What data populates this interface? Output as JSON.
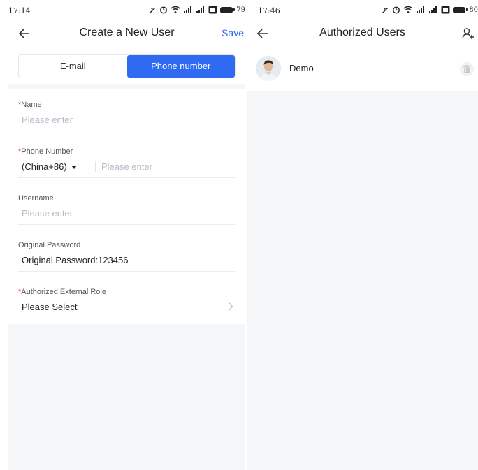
{
  "left_screen": {
    "status": {
      "time": "17:14",
      "battery": "79"
    },
    "nav": {
      "title": "Create a New User",
      "save": "Save"
    },
    "tabs": [
      {
        "label": "E-mail",
        "active": false
      },
      {
        "label": "Phone number",
        "active": true
      }
    ],
    "fields": {
      "name": {
        "required_mark": "*",
        "label": "Name",
        "placeholder": "Please enter"
      },
      "phone": {
        "required_mark": "*",
        "label": "Phone Number",
        "country_code": "(China+86)",
        "placeholder": "Please enter"
      },
      "username": {
        "label": "Username",
        "placeholder": "Please enter"
      },
      "password": {
        "label": "Original Password",
        "value": "Original Password:123456"
      },
      "role": {
        "required_mark": "*",
        "label": "Authorized External Role",
        "value": "Please Select"
      }
    }
  },
  "right_screen": {
    "status": {
      "time": "17:46",
      "battery": "80"
    },
    "nav": {
      "title": "Authorized Users"
    },
    "users": [
      {
        "name": "Demo"
      }
    ]
  },
  "colors": {
    "accent": "#2f6bf2",
    "required": "#e8463c",
    "placeholder": "#b5bcc6",
    "background": "#f5f6f8"
  }
}
